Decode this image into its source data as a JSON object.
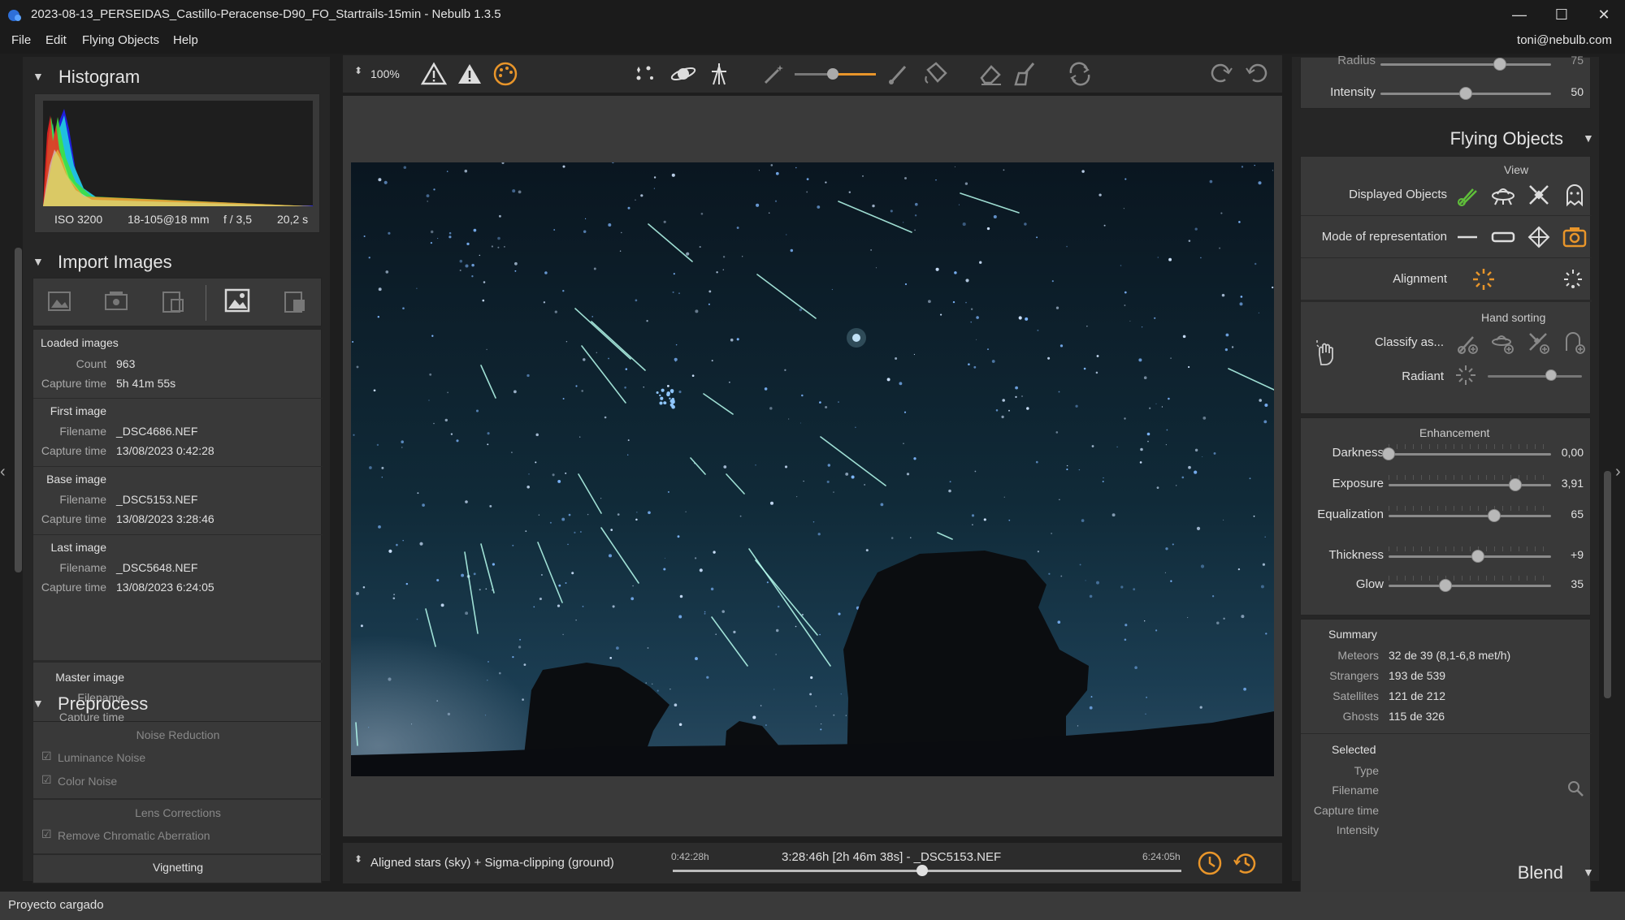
{
  "window": {
    "title": "2023-08-13_PERSEIDAS_Castillo-Peracense-D90_FO_Startrails-15min - Nebulb 1.3.5",
    "minimize": "—",
    "maximize": "☐",
    "close": "✕"
  },
  "menu": {
    "items": [
      "File",
      "Edit",
      "Flying Objects",
      "Help"
    ],
    "user": "toni@nebulb.com"
  },
  "histogram": {
    "title": "Histogram",
    "iso": "ISO 3200",
    "lens": "18-105@18 mm",
    "aperture": "f / 3,5",
    "exposure": "20,2 s"
  },
  "import": {
    "title": "Import Images",
    "loaded": {
      "header": "Loaded images",
      "count_label": "Count",
      "count": "963",
      "capture_label": "Capture time",
      "capture": "5h 41m 55s"
    },
    "first": {
      "header": "First image",
      "filename_label": "Filename",
      "filename": "_DSC4686.NEF",
      "capture_label": "Capture time",
      "capture": "13/08/2023 0:42:28"
    },
    "base": {
      "header": "Base image",
      "filename_label": "Filename",
      "filename": "_DSC5153.NEF",
      "capture_label": "Capture time",
      "capture": "13/08/2023 3:28:46"
    },
    "last": {
      "header": "Last image",
      "filename_label": "Filename",
      "filename": "_DSC5648.NEF",
      "capture_label": "Capture time",
      "capture": "13/08/2023 6:24:05"
    },
    "master": {
      "header": "Master image",
      "filename_label": "Filename",
      "capture_label": "Capture time"
    }
  },
  "preprocess": {
    "title": "Preprocess",
    "noise_header": "Noise Reduction",
    "luminance": "Luminance Noise",
    "color": "Color Noise",
    "lens_header": "Lens Corrections",
    "chromatic": "Remove Chromatic Aberration",
    "vignetting": "Vignetting"
  },
  "toolbar": {
    "zoom": "100%"
  },
  "bottombar": {
    "mode": "Aligned stars (sky) + Sigma-clipping (ground)",
    "start_time": "0:42:28h",
    "current": "3:28:46h [2h 46m 38s] - _DSC5153.NEF",
    "end_time": "6:24:05h",
    "timeline_position": 0.49
  },
  "right": {
    "top": {
      "radius_label": "Radius",
      "radius_value": "75",
      "radius_level": 0.7,
      "intensity_label": "Intensity",
      "intensity_value": "50",
      "intensity_level": 0.5
    },
    "flying_title": "Flying Objects",
    "view_header": "View",
    "displayed_objects": "Displayed Objects",
    "mode_of_representation": "Mode of representation",
    "alignment": "Alignment",
    "hand_sorting": "Hand sorting",
    "classify_as": "Classify as...",
    "radiant": "Radiant",
    "radiant_level": 0.67,
    "enhancement_header": "Enhancement",
    "sliders": [
      {
        "label": "Darkness",
        "value": "0,00",
        "level": 0.0
      },
      {
        "label": "Exposure",
        "value": "3,91",
        "level": 0.78
      },
      {
        "label": "Equalization",
        "value": "65",
        "level": 0.65
      },
      {
        "label": "Thickness",
        "value": "+9",
        "level": 0.55
      },
      {
        "label": "Glow",
        "value": "35",
        "level": 0.35
      }
    ],
    "summary": {
      "header": "Summary",
      "meteors_label": "Meteors",
      "meteors": "32 de 39 (8,1-6,8 met/h)",
      "strangers_label": "Strangers",
      "strangers": "193 de 539",
      "satellites_label": "Satellites",
      "satellites": "121 de 212",
      "ghosts_label": "Ghosts",
      "ghosts": "115 de 326"
    },
    "selected": {
      "header": "Selected",
      "type_label": "Type",
      "filename_label": "Filename",
      "capture_label": "Capture time",
      "intensity_label": "Intensity"
    },
    "blend_title": "Blend"
  },
  "status": "Proyecto cargado",
  "colors": {
    "accent_orange": "#e8952a",
    "accent_green": "#5fbf3a",
    "window_bg": "#1e1e1e"
  }
}
